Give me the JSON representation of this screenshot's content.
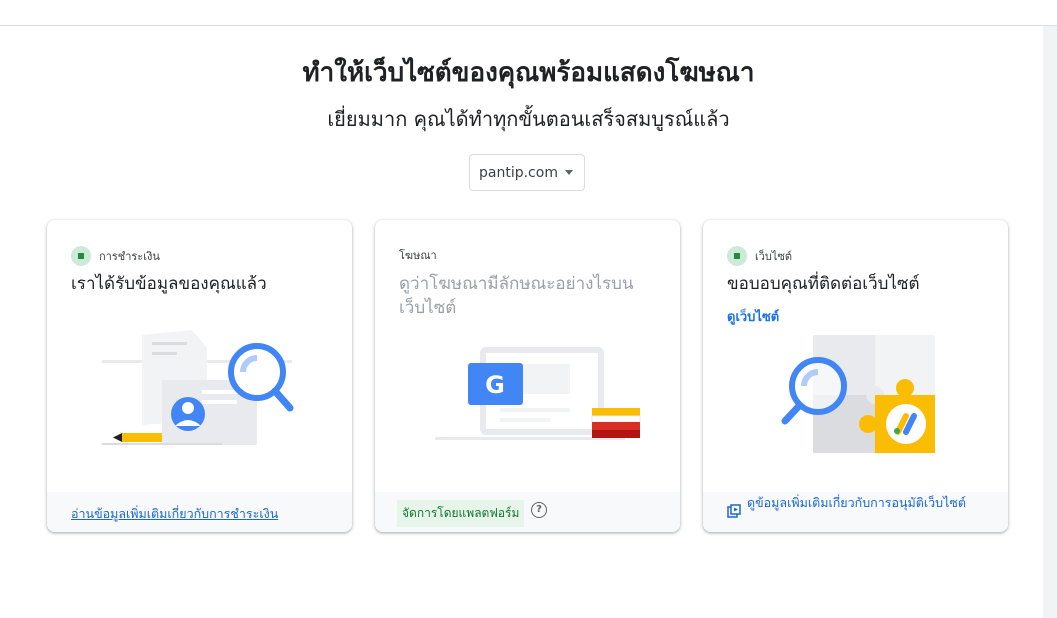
{
  "page": {
    "title": "ทำให้เว็บไซต์ของคุณพร้อมแสดงโฆษณา",
    "subtitle": "เยี่ยมมาก คุณได้ทำทุกขั้นตอนเสร็จสมบูรณ์แล้ว",
    "site_selector": {
      "value": "pantip.com"
    }
  },
  "cards": [
    {
      "status": "การชำระเงิน",
      "title": "เราได้รับข้อมูลของคุณแล้ว",
      "footer_link": "อ่านข้อมูลเพิ่มเติมเกี่ยวกับการชำระเงิน"
    },
    {
      "status": "โฆษณา",
      "title": "ดูว่าโฆษณามีลักษณะอย่างไรบนเว็บไซต์",
      "footer_badge": "จัดการโดยแพลตฟอร์ม",
      "help_glyph": "?",
      "illustration_letter": "G"
    },
    {
      "status": "เว็บไซต์",
      "title": "ขอบอบคุณที่ติดต่อเว็บไซต์",
      "link": "ดูเว็บไซต์",
      "footer_link": "ดูข้อมูลเพิ่มเติมเกี่ยวกับการอนุมัติเว็บไซต์"
    }
  ],
  "colors": {
    "status_green": "#1e8e3e",
    "link_blue": "#1a73e8",
    "google_blue": "#4285f4",
    "adsense_yellow": "#fbbc04"
  }
}
